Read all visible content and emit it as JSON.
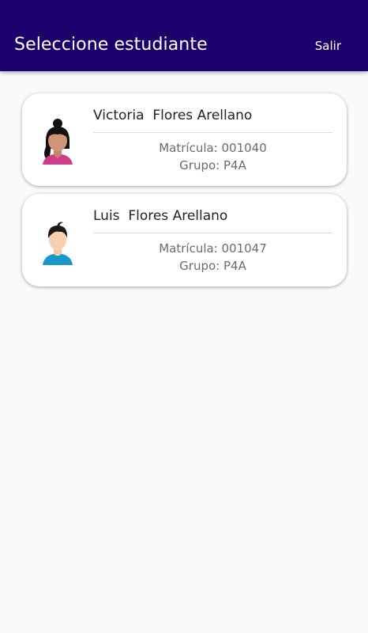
{
  "appbar": {
    "title": "Seleccione estudiante",
    "action_label": "Salir",
    "color": "#1c006b"
  },
  "students": [
    {
      "name": "Victoria  Flores Arellano",
      "matricula": "Matrícula: 001040",
      "grupo": "Grupo: P4A",
      "avatar_icon": "female-student-avatar-icon"
    },
    {
      "name": "Luis  Flores Arellano",
      "matricula": "Matrícula: 001047",
      "grupo": "Grupo: P4A",
      "avatar_icon": "male-student-avatar-icon"
    }
  ]
}
